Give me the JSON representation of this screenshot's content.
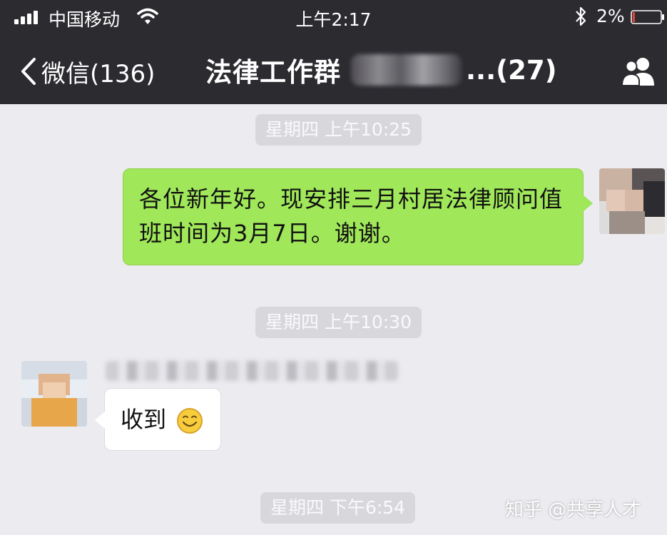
{
  "status_bar": {
    "carrier": "中国移动",
    "time": "上午2:17",
    "battery_percent": "2%"
  },
  "nav": {
    "back_label": "微信(136)",
    "chat_title": "法律工作群",
    "member_count": "...(27)"
  },
  "messages": {
    "ts1": "星期四 上午10:25",
    "outgoing_text": "各位新年好。现安排三月村居法律顾问值班时间为3月7日。谢谢。",
    "ts2": "星期四 上午10:30",
    "incoming_text": "收到",
    "ts3": "星期四 下午6:54"
  },
  "watermark": "知乎 @共享人才",
  "colors": {
    "nav_bg": "#2c2b30",
    "chat_bg": "#ecebef",
    "bubble_out": "#a0e75a",
    "bubble_in": "#ffffff",
    "timestamp_bg": "#d8d7db",
    "battery_low": "#e64340"
  },
  "icons": [
    "signal-icon",
    "wifi-icon",
    "bluetooth-icon",
    "battery-icon",
    "back-chevron-icon",
    "members-icon",
    "smile-emoji-icon"
  ]
}
